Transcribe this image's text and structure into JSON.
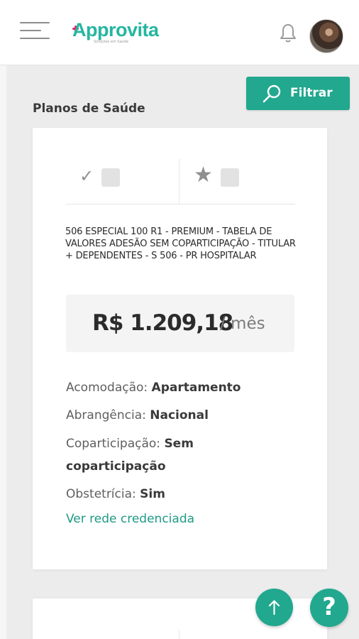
{
  "header": {
    "logo_text": "Approvita",
    "logo_tagline": "Soluções em Saúde"
  },
  "filter": {
    "label": "Filtrar"
  },
  "section": {
    "title": "Planos de Saúde"
  },
  "plan_card": {
    "compare_icon": "check-icon",
    "favorite_icon": "star-icon",
    "name": "506 ESPECIAL 100 R1 - PREMIUM - TABELA DE VALORES ADESÃO SEM COPARTICIPAÇÃO - TITULAR + DEPENDENTES - S 506 - PR HOSPITALAR",
    "price": "R$ 1.209,18",
    "period": "/ mês",
    "details": [
      {
        "label": "Acomodação:",
        "value": "Apartamento"
      },
      {
        "label": "Abrangência:",
        "value": "Nacional"
      },
      {
        "label": "Coparticipação:",
        "value": "Sem coparticipação"
      },
      {
        "label": "Obstetrícia:",
        "value": "Sim"
      }
    ],
    "network_link": "Ver rede credenciada"
  },
  "floating": {
    "scroll_top_icon": "arrow-up-icon",
    "help_label": "?"
  },
  "colors": {
    "brand": "#21a88e",
    "brand_accent": "#e2256f",
    "background": "#ececec"
  }
}
